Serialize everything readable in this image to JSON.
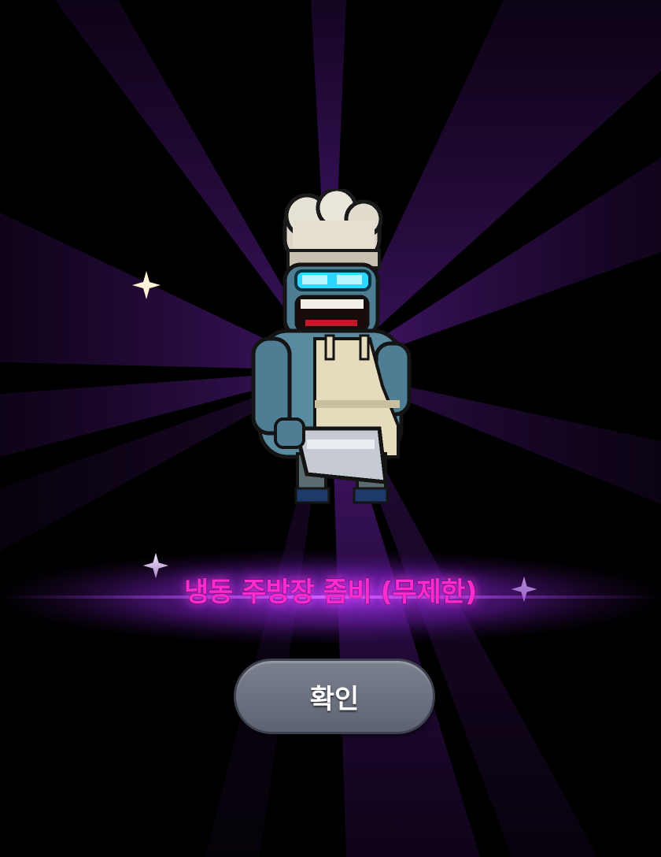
{
  "reward": {
    "name": "냉동 주방장 좀비 (무제한)",
    "character": "frozen-chef-zombie",
    "name_color": "#ff2bd0"
  },
  "confirm_button": {
    "label": "확인"
  },
  "colors": {
    "background": "#000000",
    "ray": "#5b1a8c",
    "button": "#6b6f7f",
    "sparkle_gold": "#fff4d6",
    "sparkle_violet": "#e9d2ff"
  }
}
